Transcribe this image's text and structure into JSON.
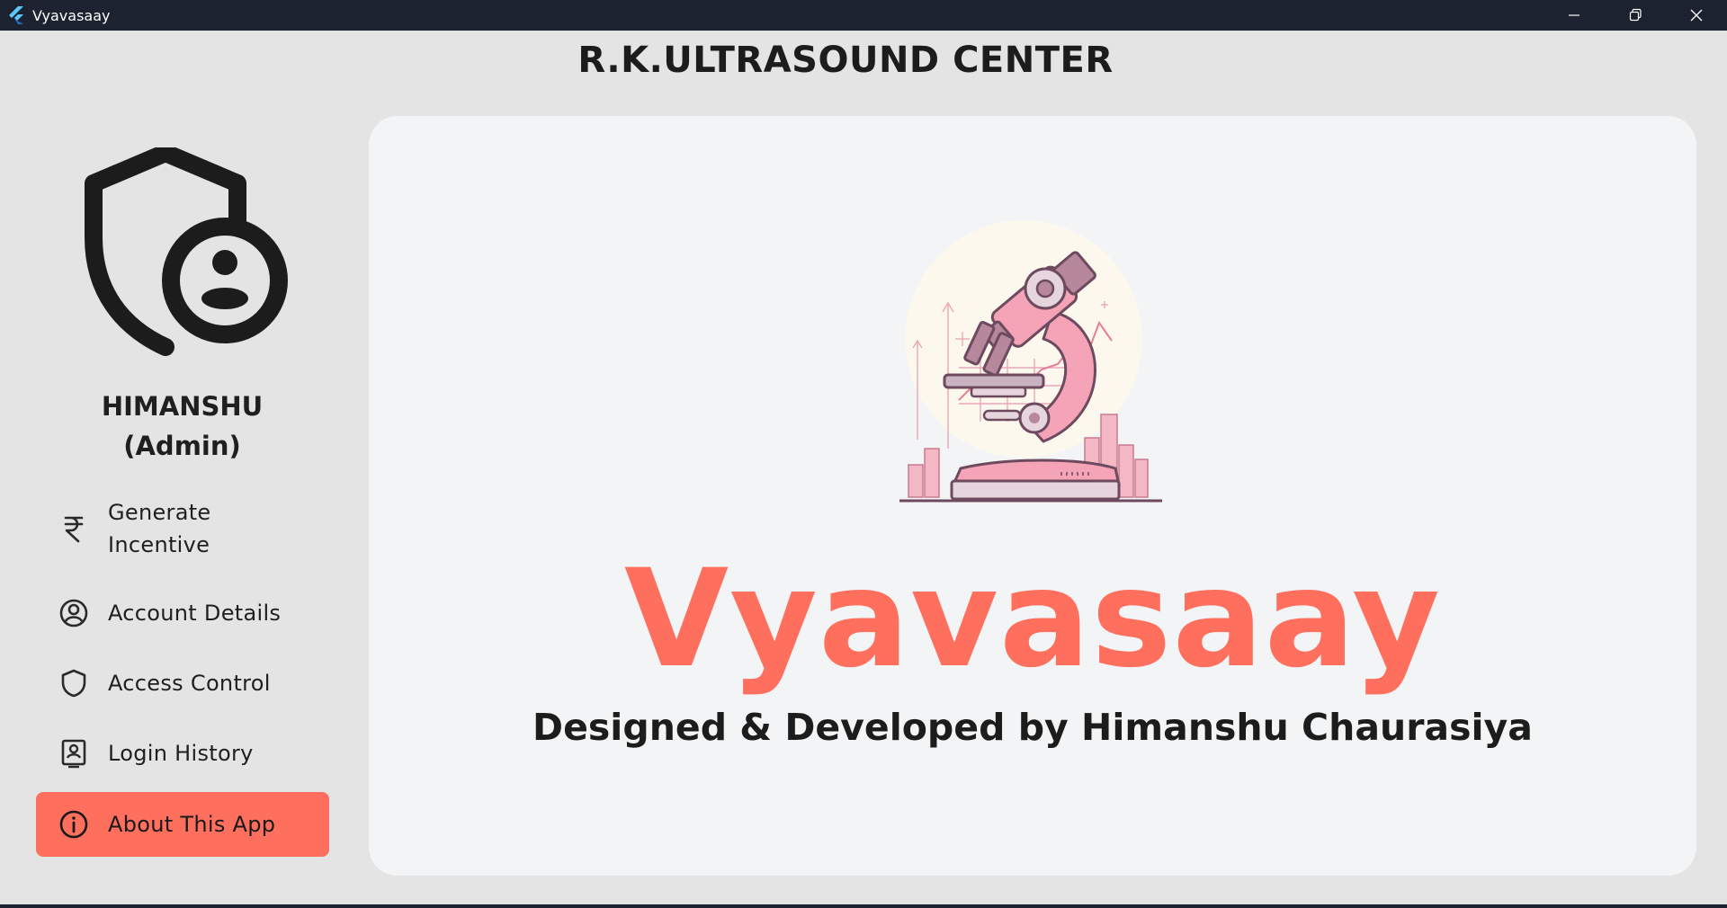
{
  "window": {
    "title": "Vyavasaay",
    "controls": [
      "minimize",
      "restore",
      "close"
    ]
  },
  "header": {
    "center_name": "R.K.ULTRASOUND CENTER"
  },
  "user": {
    "name": "HIMANSHU",
    "role": "(Admin)",
    "avatar_icon": "admin-shield-user-icon"
  },
  "sidebar": {
    "items": [
      {
        "label": "Generate Incentive",
        "label_line1": "Generate",
        "label_line2": "Incentive",
        "icon": "rupee-icon",
        "active": false
      },
      {
        "label": "Account Details",
        "icon": "account-circle-icon",
        "active": false
      },
      {
        "label": "Access Control",
        "icon": "shield-icon",
        "active": false
      },
      {
        "label": "Login History",
        "icon": "login-history-icon",
        "active": false
      },
      {
        "label": "About This App",
        "icon": "info-icon",
        "active": true
      }
    ]
  },
  "main": {
    "illustration": "microscope-illustration",
    "brand_title": "Vyavasaay",
    "credits": "Designed & Developed by Himanshu Chaurasiya"
  },
  "colors": {
    "accent": "#ff6f5e",
    "titlebar_bg": "#1c2230",
    "page_bg": "#e4e4e4",
    "card_bg": "#f3f4f6"
  }
}
